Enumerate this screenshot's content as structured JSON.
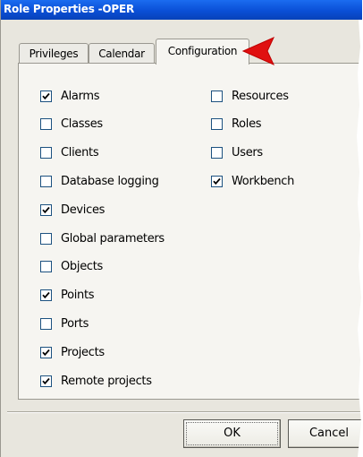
{
  "window": {
    "title": "Role Properties -OPER"
  },
  "tabs": [
    {
      "label": "Privileges",
      "active": false
    },
    {
      "label": "Calendar",
      "active": false
    },
    {
      "label": "Configuration",
      "active": true
    }
  ],
  "checkboxes": {
    "left": [
      {
        "label": "Alarms",
        "checked": true
      },
      {
        "label": "Classes",
        "checked": false
      },
      {
        "label": "Clients",
        "checked": false
      },
      {
        "label": "Database logging",
        "checked": false
      },
      {
        "label": "Devices",
        "checked": true
      },
      {
        "label": "Global parameters",
        "checked": false
      },
      {
        "label": "Objects",
        "checked": false
      },
      {
        "label": "Points",
        "checked": true
      },
      {
        "label": "Ports",
        "checked": false
      },
      {
        "label": "Projects",
        "checked": true
      },
      {
        "label": "Remote projects",
        "checked": true
      }
    ],
    "right": [
      {
        "label": "Resources",
        "checked": false
      },
      {
        "label": "Roles",
        "checked": false
      },
      {
        "label": "Users",
        "checked": false
      },
      {
        "label": "Workbench",
        "checked": true
      }
    ]
  },
  "buttons": {
    "ok": "OK",
    "cancel": "Cancel"
  },
  "colors": {
    "titlebar": "#0a4fd6",
    "annotation_arrow": "#e01010",
    "dialog_bg": "#e8e6de"
  }
}
